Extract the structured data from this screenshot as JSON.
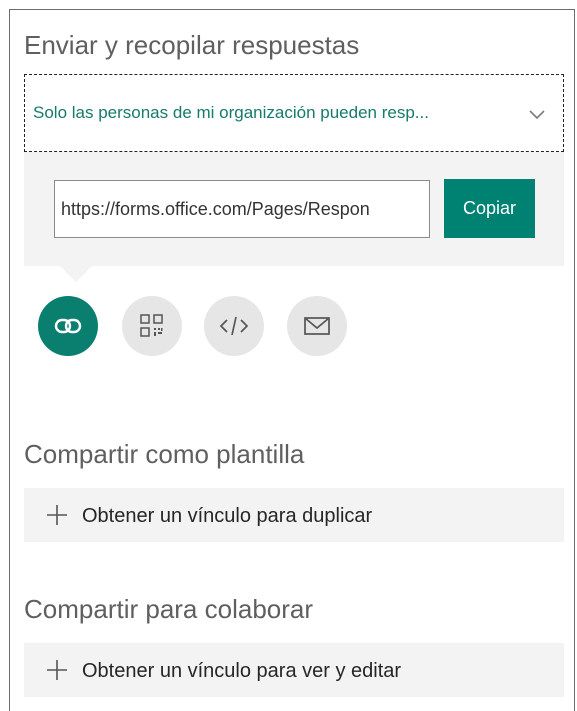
{
  "send_section": {
    "title": "Enviar y recopilar respuestas",
    "audience_dropdown": {
      "selected": "Solo las personas de mi organización pueden resp..."
    },
    "link": {
      "url": "https://forms.office.com/Pages/Respon",
      "copy_label": "Copiar"
    },
    "share_methods": [
      {
        "icon": "link-icon",
        "active": true
      },
      {
        "icon": "qr-code-icon",
        "active": false
      },
      {
        "icon": "embed-code-icon",
        "active": false
      },
      {
        "icon": "email-icon",
        "active": false
      }
    ]
  },
  "template_section": {
    "title": "Compartir como plantilla",
    "action_label": "Obtener un vínculo para duplicar"
  },
  "collab_section": {
    "title": "Compartir para colaborar",
    "action_label": "Obtener un vínculo para ver y editar"
  },
  "colors": {
    "accent": "#008272",
    "dropdown_text": "#167a6c",
    "panel_gray": "#f3f3f3",
    "icon_inactive_bg": "#e6e6e6"
  }
}
